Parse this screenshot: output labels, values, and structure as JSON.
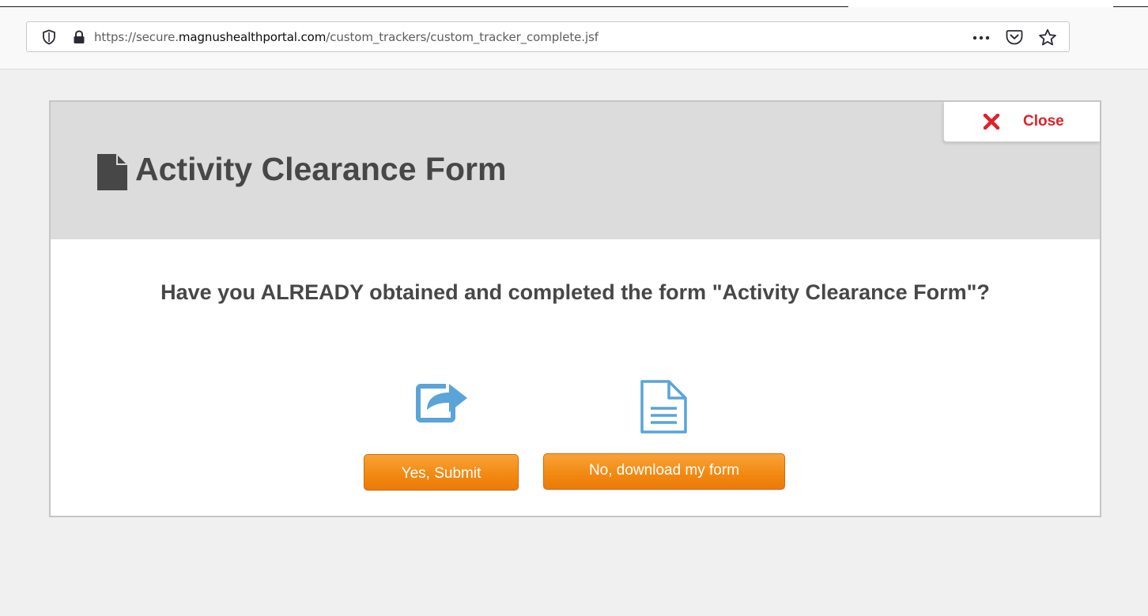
{
  "browser": {
    "url": {
      "prefix": "https://secure.",
      "domain": "magnushealthportal.com",
      "path": "/custom_trackers/custom_tracker_complete.jsf"
    },
    "icons": [
      "shield-icon",
      "lock-icon",
      "more-icon",
      "pocket-icon",
      "star-icon"
    ]
  },
  "modal": {
    "title": "Activity Clearance Form",
    "close_label": "Close",
    "question": "Have you ALREADY obtained and completed the form \"Activity Clearance Form\"?",
    "yes_button": "Yes, Submit",
    "no_button": "No, download my form",
    "icons": [
      "document-icon",
      "close-x-icon",
      "share-icon",
      "file-text-icon"
    ]
  },
  "colors": {
    "accent_orange": "#f28a13",
    "close_red": "#e0212a",
    "icon_blue": "#5aa4d8",
    "header_gray": "#dcdcdc",
    "title_gray": "#474747"
  }
}
